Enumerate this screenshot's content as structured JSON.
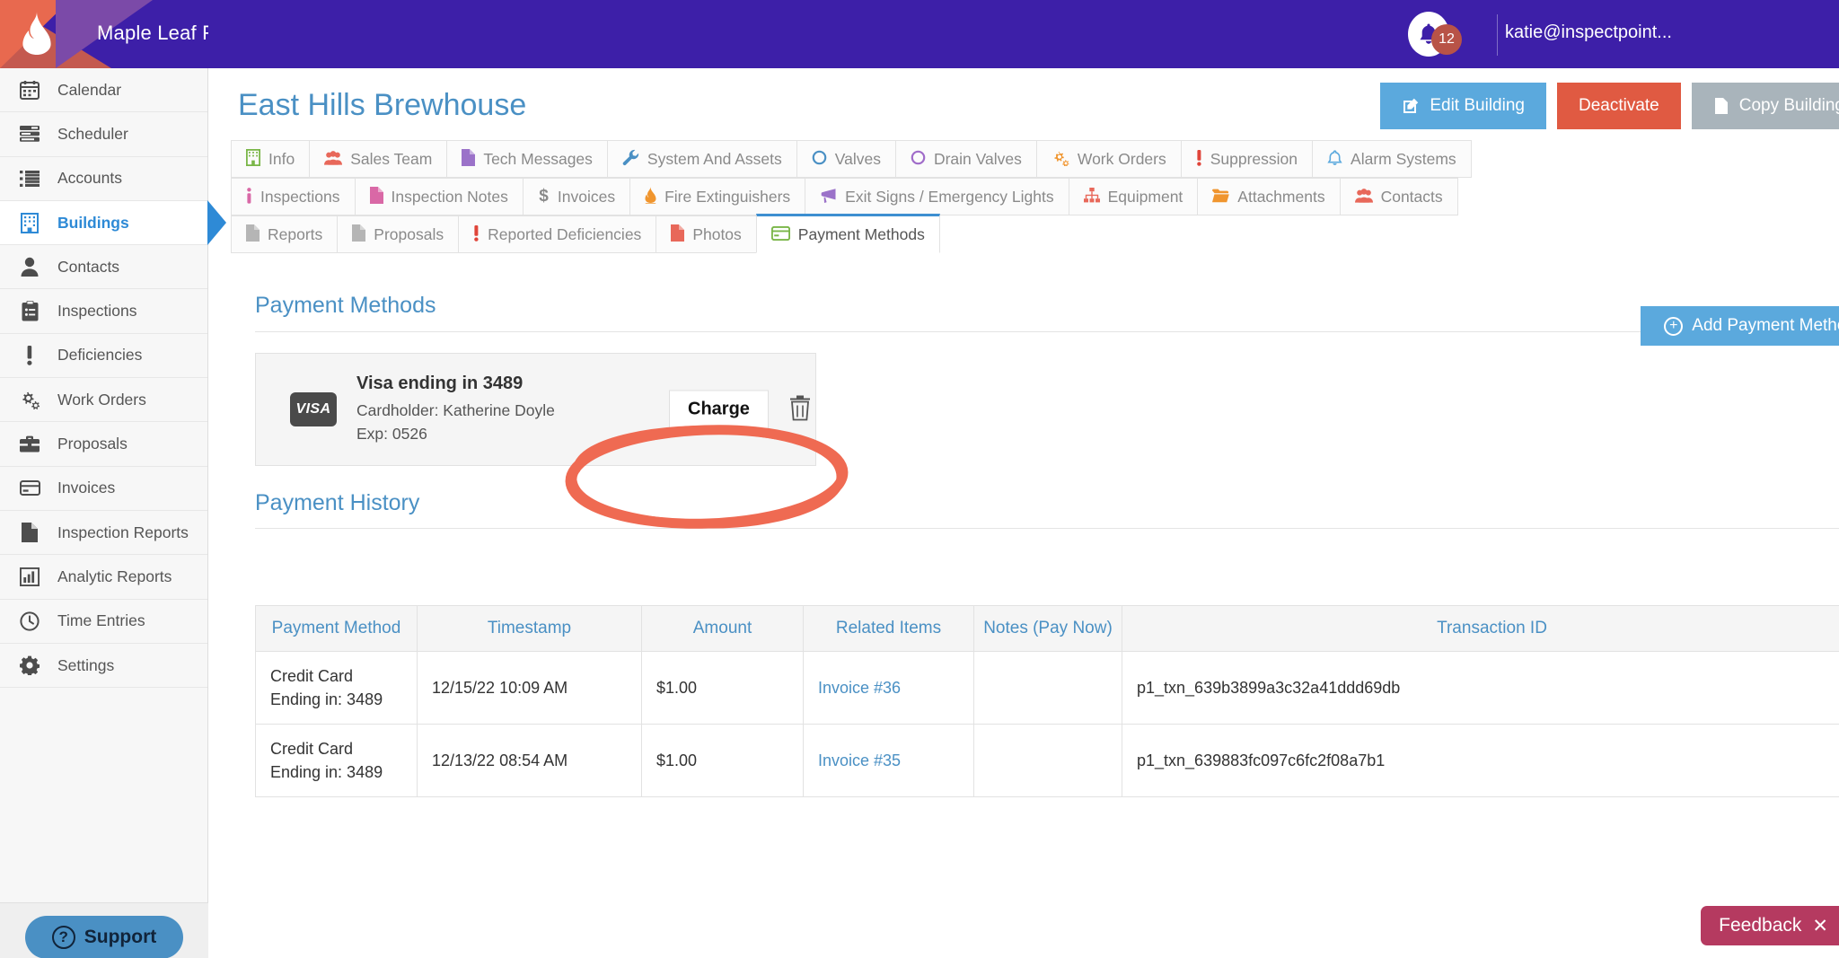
{
  "topbar": {
    "brand": "Maple Leaf Fire Protection",
    "notification_count": "12",
    "user_email": "katie@inspectpoint...",
    "bg_color": "#3d1fa8"
  },
  "sidebar": {
    "items": [
      {
        "label": "Calendar",
        "icon": "calendar-icon",
        "active": false
      },
      {
        "label": "Scheduler",
        "icon": "scheduler-icon",
        "active": false
      },
      {
        "label": "Accounts",
        "icon": "list-icon",
        "active": false
      },
      {
        "label": "Buildings",
        "icon": "building-icon",
        "active": true
      },
      {
        "label": "Contacts",
        "icon": "person-icon",
        "active": false
      },
      {
        "label": "Inspections",
        "icon": "clipboard-icon",
        "active": false
      },
      {
        "label": "Deficiencies",
        "icon": "exclamation-icon",
        "active": false
      },
      {
        "label": "Work Orders",
        "icon": "gears-icon",
        "active": false
      },
      {
        "label": "Proposals",
        "icon": "briefcase-icon",
        "active": false
      },
      {
        "label": "Invoices",
        "icon": "credit-card-icon",
        "active": false
      },
      {
        "label": "Inspection Reports",
        "icon": "document-icon",
        "active": false
      },
      {
        "label": "Analytic Reports",
        "icon": "bar-chart-icon",
        "active": false
      },
      {
        "label": "Time Entries",
        "icon": "clock-icon",
        "active": false
      },
      {
        "label": "Settings",
        "icon": "gear-icon",
        "active": false
      }
    ],
    "support_label": "Support",
    "active_color": "#2e8ad6"
  },
  "header": {
    "title": "East Hills Brewhouse",
    "buttons": [
      {
        "label": "Edit Building",
        "icon": "edit-icon",
        "color": "#5ba9dd"
      },
      {
        "label": "Deactivate",
        "icon": "",
        "color": "#e05a42"
      },
      {
        "label": "Copy Building",
        "icon": "document-icon",
        "color": "#a9b4bb"
      }
    ]
  },
  "tabs": {
    "row1": [
      {
        "label": "Info",
        "icon": "building-icon",
        "color": "#7ab648",
        "active": false
      },
      {
        "label": "Sales Team",
        "icon": "people-icon",
        "color": "#e8685a",
        "active": false
      },
      {
        "label": "Tech Messages",
        "icon": "document-icon",
        "color": "#9b72c9",
        "active": false
      },
      {
        "label": "System And Assets",
        "icon": "wrench-icon",
        "color": "#4a90c4",
        "active": false
      },
      {
        "label": "Valves",
        "icon": "circle-icon",
        "color": "#4a90c4",
        "active": false
      },
      {
        "label": "Drain Valves",
        "icon": "circle-icon",
        "color": "#a06cc9",
        "active": false
      },
      {
        "label": "Work Orders",
        "icon": "gears-icon",
        "color": "#f0952e",
        "active": false
      },
      {
        "label": "Suppression",
        "icon": "exclamation-icon",
        "color": "#e0453a",
        "active": false
      },
      {
        "label": "Alarm Systems",
        "icon": "bell-icon",
        "color": "#5ba9dd",
        "active": false
      }
    ],
    "row2": [
      {
        "label": "Inspections",
        "icon": "info-icon",
        "color": "#d968a6",
        "active": false
      },
      {
        "label": "Inspection Notes",
        "icon": "document-icon",
        "color": "#d968a6",
        "active": false
      },
      {
        "label": "Invoices",
        "icon": "dollar-icon",
        "color": "#8a8a8a",
        "active": false
      },
      {
        "label": "Fire Extinguishers",
        "icon": "flame-icon",
        "color": "#f0952e",
        "active": false
      },
      {
        "label": "Exit Signs / Emergency Lights",
        "icon": "megaphone-icon",
        "color": "#9b72c9",
        "active": false
      },
      {
        "label": "Equipment",
        "icon": "sitemap-icon",
        "color": "#e8685a",
        "active": false
      },
      {
        "label": "Attachments",
        "icon": "folder-icon",
        "color": "#f0952e",
        "active": false
      },
      {
        "label": "Contacts",
        "icon": "people-icon",
        "color": "#e8685a",
        "active": false
      }
    ],
    "row3": [
      {
        "label": "Reports",
        "icon": "document-icon",
        "color": "#b5b5b5",
        "active": false
      },
      {
        "label": "Proposals",
        "icon": "document-icon",
        "color": "#b5b5b5",
        "active": false
      },
      {
        "label": "Reported Deficiencies",
        "icon": "exclamation-icon",
        "color": "#e0453a",
        "active": false
      },
      {
        "label": "Photos",
        "icon": "document-icon",
        "color": "#e8685a",
        "active": false
      },
      {
        "label": "Payment Methods",
        "icon": "credit-card-icon",
        "color": "#7ab648",
        "active": true
      }
    ]
  },
  "payment_methods": {
    "section_title": "Payment Methods",
    "add_button_label": "Add Payment Method",
    "card": {
      "brand_logo": "VISA",
      "title": "Visa ending in 3489",
      "cardholder": "Cardholder: Katherine Doyle",
      "expiry": "Exp: 0526",
      "charge_label": "Charge",
      "delete_icon": "trash-icon"
    }
  },
  "payment_history": {
    "section_title": "Payment History",
    "columns": [
      "Payment Method",
      "Timestamp",
      "Amount",
      "Related Items",
      "Notes (Pay Now)",
      "Transaction ID"
    ],
    "rows": [
      {
        "method_line1": "Credit Card",
        "method_line2": "Ending in: 3489",
        "timestamp": "12/15/22 10:09 AM",
        "amount": "$1.00",
        "related": "Invoice #36",
        "notes": "",
        "transaction_id": "p1_txn_639b3899a3c32a41ddd69db"
      },
      {
        "method_line1": "Credit Card",
        "method_line2": "Ending in: 3489",
        "timestamp": "12/13/22 08:54 AM",
        "amount": "$1.00",
        "related": "Invoice #35",
        "notes": "",
        "transaction_id": "p1_txn_639883fc097c6fc2f08a7b1"
      }
    ]
  },
  "feedback": {
    "label": "Feedback"
  },
  "annotation": {
    "shape": "hand-drawn-ellipse",
    "color": "#ef6a52"
  }
}
